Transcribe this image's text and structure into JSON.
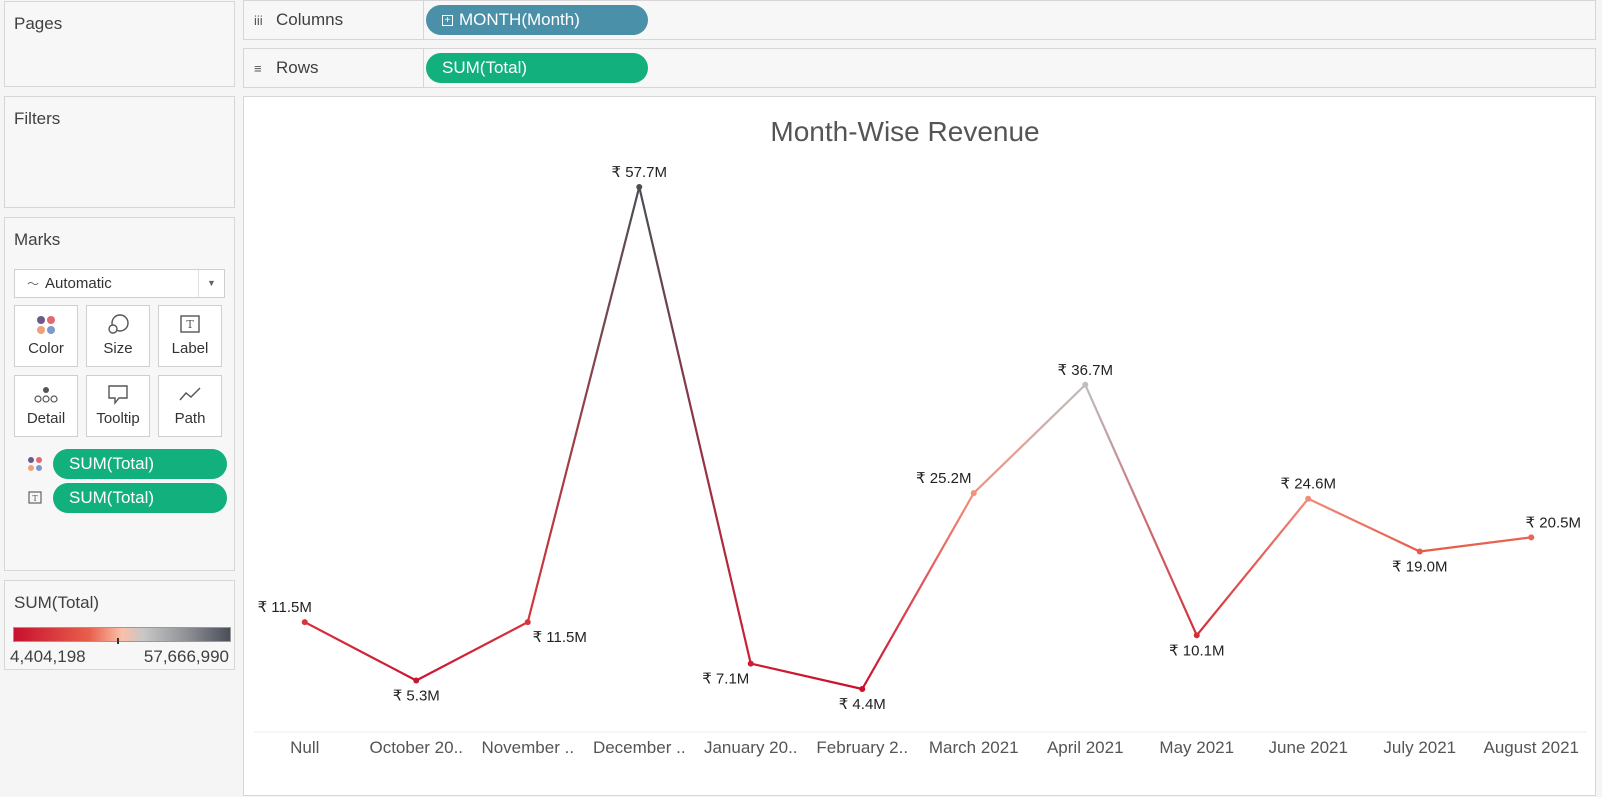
{
  "cards": {
    "pages_title": "Pages",
    "filters_title": "Filters",
    "marks_title": "Marks"
  },
  "shelves": {
    "columns_label": "Columns",
    "columns_pill": "MONTH(Month)",
    "rows_label": "Rows",
    "rows_pill": "SUM(Total)"
  },
  "marks": {
    "mark_type": "Automatic",
    "buttons": {
      "color": "Color",
      "size": "Size",
      "label": "Label",
      "detail": "Detail",
      "tooltip": "Tooltip",
      "path": "Path"
    },
    "color_pill": "SUM(Total)",
    "label_pill": "SUM(Total)"
  },
  "legend": {
    "title": "SUM(Total)",
    "min": "4,404,198",
    "max": "57,666,990"
  },
  "colors": {
    "pill_blue": "#4a90a8",
    "pill_green": "#12b07c",
    "low": "#c8102e",
    "mid": "#fbbfa8",
    "high": "#4a4e57"
  },
  "chart_data": {
    "type": "line",
    "title": "Month-Wise Revenue",
    "categories": [
      "Null",
      "October 20..",
      "November ..",
      "December ..",
      "January 20..",
      "February 2..",
      "March 2021",
      "April 2021",
      "May 2021",
      "June 2021",
      "July 2021",
      "August 2021"
    ],
    "values": [
      11.5,
      5.3,
      11.5,
      57.7,
      7.1,
      4.4,
      25.2,
      36.7,
      10.1,
      24.6,
      19.0,
      20.5
    ],
    "labels": [
      "₹ 11.5M",
      "₹ 5.3M",
      "₹ 11.5M",
      "₹ 57.7M",
      "₹ 7.1M",
      "₹ 4.4M",
      "₹ 25.2M",
      "₹ 36.7M",
      "₹ 10.1M",
      "₹ 24.6M",
      "₹ 19.0M",
      "₹ 20.5M"
    ],
    "label_side": [
      "above",
      "below",
      "below",
      "above",
      "below",
      "below",
      "above",
      "above",
      "below",
      "above",
      "below",
      "above"
    ],
    "ylim": [
      0,
      60
    ],
    "xlabel": "",
    "ylabel": "",
    "grid": false,
    "color_scale": "red-gray diverging by SUM(Total)"
  }
}
